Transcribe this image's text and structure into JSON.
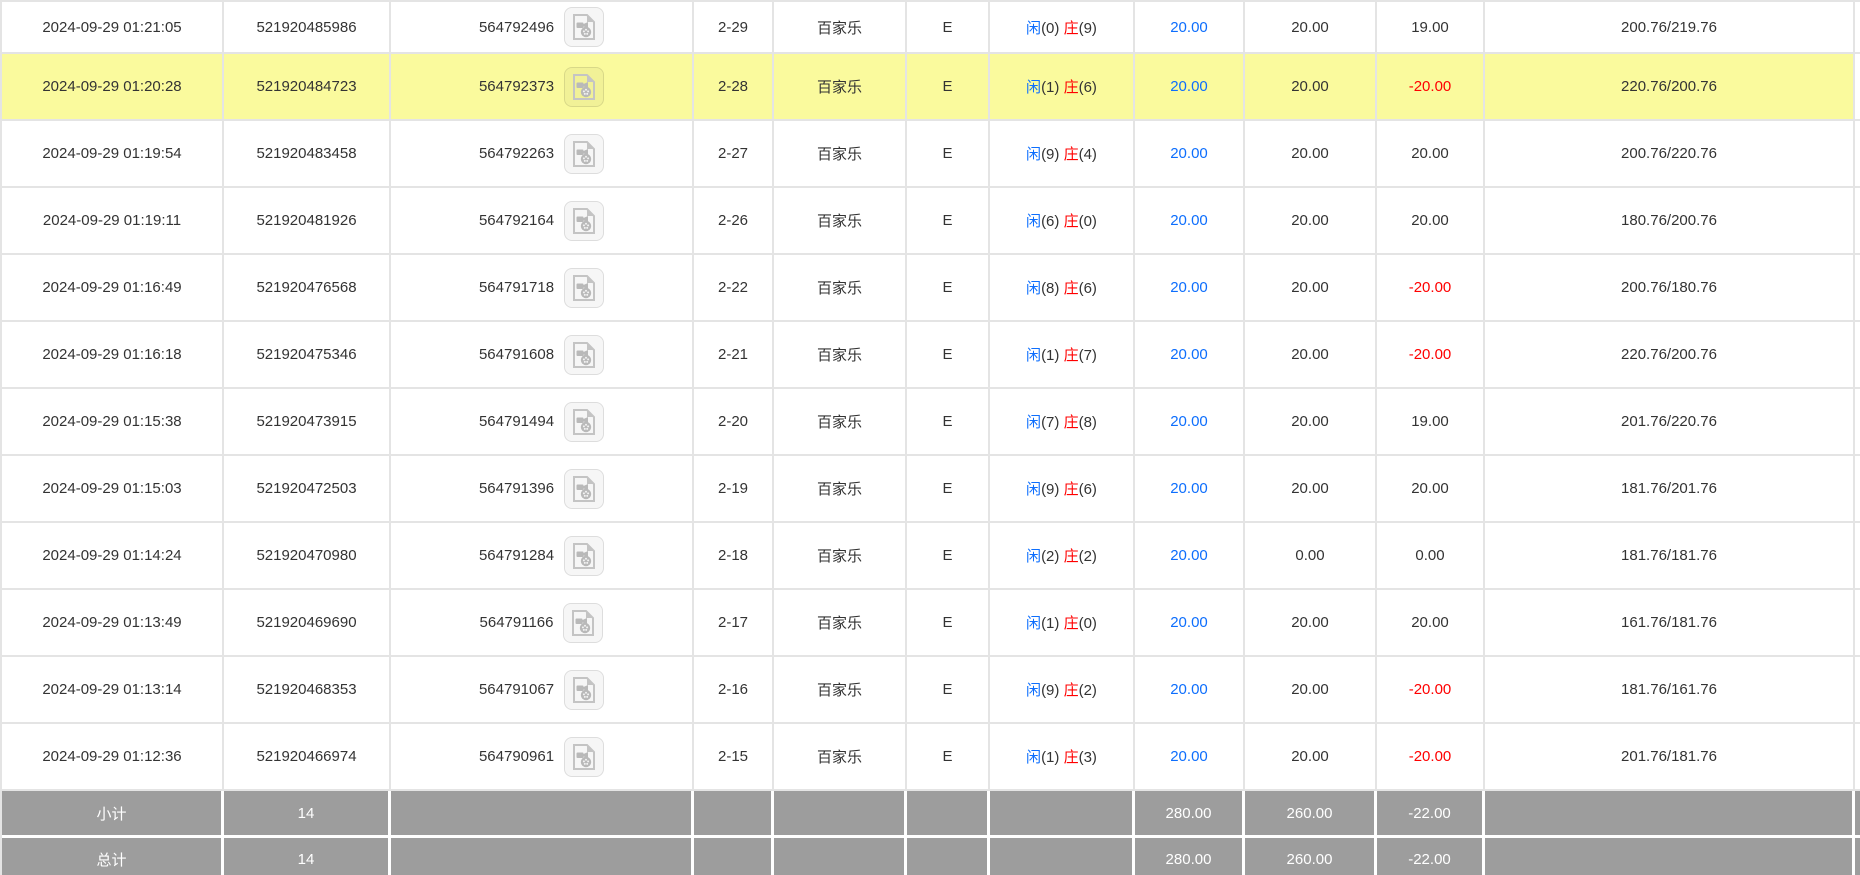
{
  "table": {
    "labels": {
      "player": "闲",
      "banker": "庄"
    },
    "icons": {
      "video_replay": "video-file-with-film-reel-icon"
    },
    "colors": {
      "highlight_yellow": "#fafa9d",
      "summary_gray": "#9d9d9d",
      "accent_blue": "#0d6efd",
      "negative_red": "#ff0000",
      "border_gray": "#e4e4e4",
      "text_dark": "#333333",
      "summary_text": "#ffffff"
    },
    "rows": [
      {
        "time": "2024-09-29 01:21:05",
        "bet_id": "521920485986",
        "round_id": "564792496",
        "round": "2-29",
        "game": "百家乐",
        "table_code": "E",
        "player_pts": "0",
        "banker_pts": "9",
        "bet": "20.00",
        "valid": "20.00",
        "win_loss": "19.00",
        "balance": "200.76/219.76",
        "highlighted": false
      },
      {
        "time": "2024-09-29 01:20:28",
        "bet_id": "521920484723",
        "round_id": "564792373",
        "round": "2-28",
        "game": "百家乐",
        "table_code": "E",
        "player_pts": "1",
        "banker_pts": "6",
        "bet": "20.00",
        "valid": "20.00",
        "win_loss": "-20.00",
        "balance": "220.76/200.76",
        "highlighted": true
      },
      {
        "time": "2024-09-29 01:19:54",
        "bet_id": "521920483458",
        "round_id": "564792263",
        "round": "2-27",
        "game": "百家乐",
        "table_code": "E",
        "player_pts": "9",
        "banker_pts": "4",
        "bet": "20.00",
        "valid": "20.00",
        "win_loss": "20.00",
        "balance": "200.76/220.76",
        "highlighted": false
      },
      {
        "time": "2024-09-29 01:19:11",
        "bet_id": "521920481926",
        "round_id": "564792164",
        "round": "2-26",
        "game": "百家乐",
        "table_code": "E",
        "player_pts": "6",
        "banker_pts": "0",
        "bet": "20.00",
        "valid": "20.00",
        "win_loss": "20.00",
        "balance": "180.76/200.76",
        "highlighted": false
      },
      {
        "time": "2024-09-29 01:16:49",
        "bet_id": "521920476568",
        "round_id": "564791718",
        "round": "2-22",
        "game": "百家乐",
        "table_code": "E",
        "player_pts": "8",
        "banker_pts": "6",
        "bet": "20.00",
        "valid": "20.00",
        "win_loss": "-20.00",
        "balance": "200.76/180.76",
        "highlighted": false
      },
      {
        "time": "2024-09-29 01:16:18",
        "bet_id": "521920475346",
        "round_id": "564791608",
        "round": "2-21",
        "game": "百家乐",
        "table_code": "E",
        "player_pts": "1",
        "banker_pts": "7",
        "bet": "20.00",
        "valid": "20.00",
        "win_loss": "-20.00",
        "balance": "220.76/200.76",
        "highlighted": false
      },
      {
        "time": "2024-09-29 01:15:38",
        "bet_id": "521920473915",
        "round_id": "564791494",
        "round": "2-20",
        "game": "百家乐",
        "table_code": "E",
        "player_pts": "7",
        "banker_pts": "8",
        "bet": "20.00",
        "valid": "20.00",
        "win_loss": "19.00",
        "balance": "201.76/220.76",
        "highlighted": false
      },
      {
        "time": "2024-09-29 01:15:03",
        "bet_id": "521920472503",
        "round_id": "564791396",
        "round": "2-19",
        "game": "百家乐",
        "table_code": "E",
        "player_pts": "9",
        "banker_pts": "6",
        "bet": "20.00",
        "valid": "20.00",
        "win_loss": "20.00",
        "balance": "181.76/201.76",
        "highlighted": false
      },
      {
        "time": "2024-09-29 01:14:24",
        "bet_id": "521920470980",
        "round_id": "564791284",
        "round": "2-18",
        "game": "百家乐",
        "table_code": "E",
        "player_pts": "2",
        "banker_pts": "2",
        "bet": "20.00",
        "valid": "0.00",
        "win_loss": "0.00",
        "balance": "181.76/181.76",
        "highlighted": false
      },
      {
        "time": "2024-09-29 01:13:49",
        "bet_id": "521920469690",
        "round_id": "564791166",
        "round": "2-17",
        "game": "百家乐",
        "table_code": "E",
        "player_pts": "1",
        "banker_pts": "0",
        "bet": "20.00",
        "valid": "20.00",
        "win_loss": "20.00",
        "balance": "161.76/181.76",
        "highlighted": false
      },
      {
        "time": "2024-09-29 01:13:14",
        "bet_id": "521920468353",
        "round_id": "564791067",
        "round": "2-16",
        "game": "百家乐",
        "table_code": "E",
        "player_pts": "9",
        "banker_pts": "2",
        "bet": "20.00",
        "valid": "20.00",
        "win_loss": "-20.00",
        "balance": "181.76/161.76",
        "highlighted": false
      },
      {
        "time": "2024-09-29 01:12:36",
        "bet_id": "521920466974",
        "round_id": "564790961",
        "round": "2-15",
        "game": "百家乐",
        "table_code": "E",
        "player_pts": "1",
        "banker_pts": "3",
        "bet": "20.00",
        "valid": "20.00",
        "win_loss": "-20.00",
        "balance": "201.76/181.76",
        "highlighted": false
      }
    ],
    "summary": [
      {
        "label": "小计",
        "count": "14",
        "bet": "280.00",
        "valid": "260.00",
        "win_loss": "-22.00"
      },
      {
        "label": "总计",
        "count": "14",
        "bet": "280.00",
        "valid": "260.00",
        "win_loss": "-22.00"
      }
    ]
  }
}
